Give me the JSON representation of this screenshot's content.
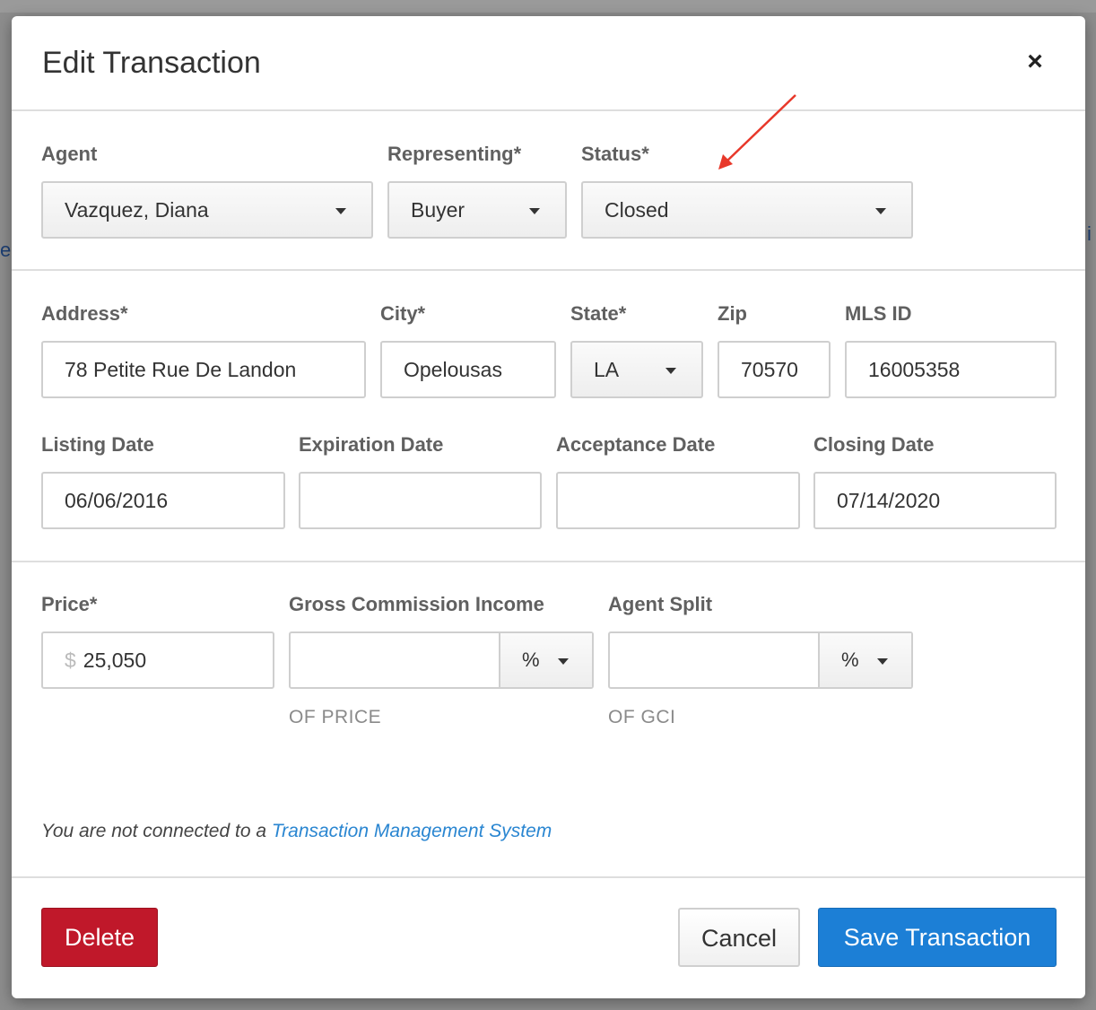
{
  "modal": {
    "title": "Edit Transaction",
    "close_glyph": "×"
  },
  "fields": {
    "agent": {
      "label": "Agent",
      "value": "Vazquez, Diana"
    },
    "representing": {
      "label": "Representing*",
      "value": "Buyer"
    },
    "status": {
      "label": "Status*",
      "value": "Closed"
    },
    "address": {
      "label": "Address*",
      "value": "78 Petite Rue De Landon"
    },
    "city": {
      "label": "City*",
      "value": "Opelousas"
    },
    "state": {
      "label": "State*",
      "value": "LA"
    },
    "zip": {
      "label": "Zip",
      "value": "70570"
    },
    "mls_id": {
      "label": "MLS ID",
      "value": "16005358"
    },
    "listing_date": {
      "label": "Listing Date",
      "value": "06/06/2016"
    },
    "expiration_date": {
      "label": "Expiration Date",
      "value": ""
    },
    "acceptance_date": {
      "label": "Acceptance Date",
      "value": ""
    },
    "closing_date": {
      "label": "Closing Date",
      "value": "07/14/2020"
    },
    "price": {
      "label": "Price*",
      "currency_symbol": "$",
      "value": "25,050"
    },
    "gci": {
      "label": "Gross Commission Income",
      "value": "",
      "unit": "%",
      "helper": "OF PRICE"
    },
    "agent_split": {
      "label": "Agent Split",
      "value": "",
      "unit": "%",
      "helper": "OF GCI"
    }
  },
  "note": {
    "text": "You are not connected to a ",
    "link": "Transaction Management System"
  },
  "buttons": {
    "delete": "Delete",
    "cancel": "Cancel",
    "save": "Save Transaction"
  },
  "colors": {
    "primary": "#1c7fd6",
    "danger": "#c0182a",
    "link": "#2a86d1",
    "annotation_arrow": "#e8382a"
  }
}
